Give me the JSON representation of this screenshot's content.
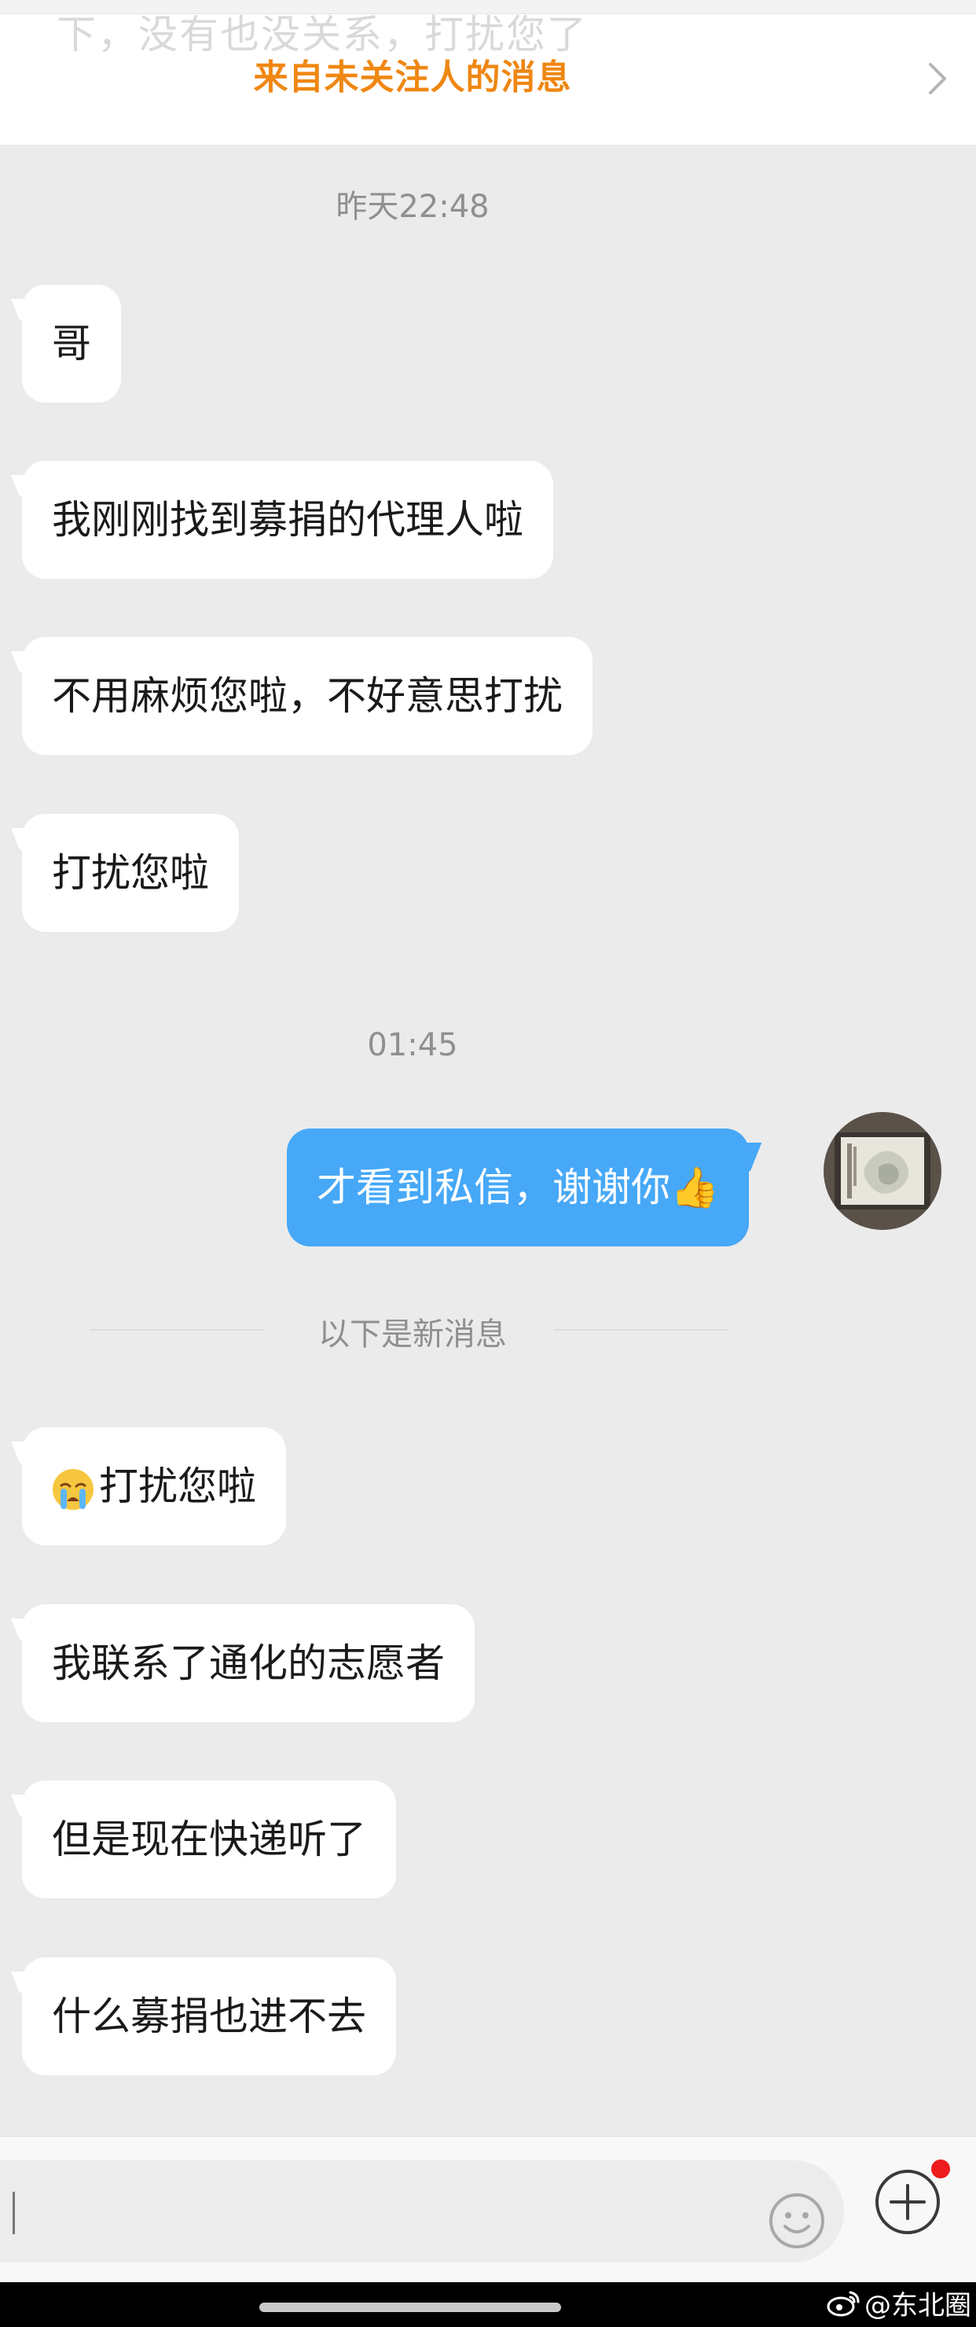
{
  "header": {
    "faded_preview": "下，没有也没关系，打扰您了",
    "stranger_banner": "来自未关注人的消息",
    "chevron_icon": "chevron-right-icon"
  },
  "messages": [
    {
      "type": "timestamp",
      "text": "昨天22:48"
    },
    {
      "type": "incoming",
      "text": "哥"
    },
    {
      "type": "incoming",
      "text": "我刚刚找到募捐的代理人啦"
    },
    {
      "type": "incoming",
      "text": "不用麻烦您啦，不好意思打扰"
    },
    {
      "type": "incoming",
      "text": "打扰您啦"
    },
    {
      "type": "timestamp",
      "text": "01:45"
    },
    {
      "type": "outgoing",
      "text": "才看到私信，谢谢你👍"
    },
    {
      "type": "incoming",
      "emoji": "crying-face-icon",
      "text": "打扰您啦"
    },
    {
      "type": "incoming",
      "text": "我联系了通化的志愿者"
    },
    {
      "type": "incoming",
      "text": "但是现在快递听了"
    },
    {
      "type": "incoming",
      "text": "什么募捐也进不去"
    }
  ],
  "new_messages_divider": "以下是新消息",
  "composer": {
    "input_value": "",
    "emoji_icon": "smiley-icon",
    "plus_icon": "plus-circle-icon",
    "has_notification_dot": true
  },
  "watermark": {
    "icon": "weibo-icon",
    "text": "@东北圈"
  },
  "colors": {
    "banner_orange": "#ef8712",
    "outgoing_bubble": "#46a8f7",
    "chat_background": "#ebebeb",
    "notification_red": "#ee1c1c"
  }
}
